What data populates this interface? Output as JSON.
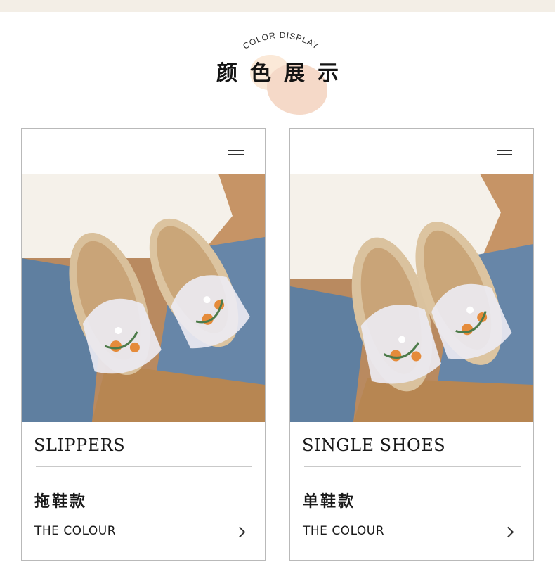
{
  "header": {
    "subtitle_en": "COLOR DISPLAY",
    "title_cn": "颜色展示"
  },
  "cards": [
    {
      "image_alt": "embroidered linen slippers held on lap",
      "title_en": "SLIPPERS",
      "title_cn": "拖鞋款",
      "link_label": "THE COLOUR",
      "icons": [
        "menu-icon",
        "chevron-right-icon"
      ]
    },
    {
      "image_alt": "embroidered linen single shoes held on lap",
      "title_en": "SINGLE SHOES",
      "title_cn": "单鞋款",
      "link_label": "THE COLOUR",
      "icons": [
        "menu-icon",
        "chevron-right-icon"
      ]
    }
  ],
  "colors": {
    "top_band": "#f3eee6",
    "accent_blob": "#f5d9c8",
    "border": "#b9b9b9",
    "text": "#1a1a1a"
  }
}
